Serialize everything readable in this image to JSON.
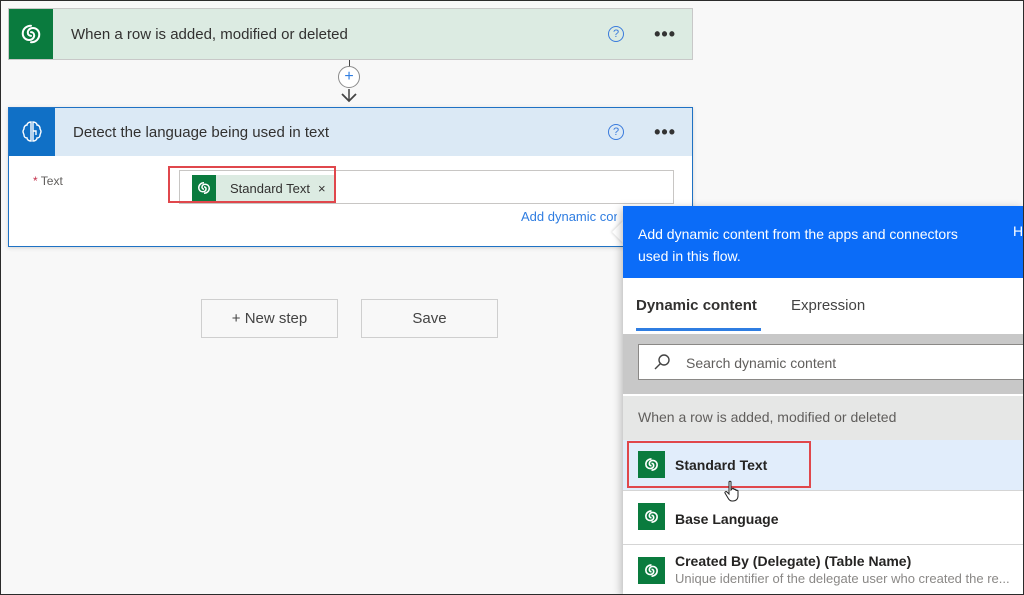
{
  "trigger": {
    "title": "When a row is added, modified or deleted",
    "icon": "dataverse-icon",
    "help_icon": "?",
    "more_icon": "•••",
    "color": "#0a7b3e"
  },
  "connector": {
    "add_icon": "+"
  },
  "action": {
    "title": "Detect the language being used in text",
    "icon": "ai-brain-icon",
    "help_icon": "?",
    "more_icon": "•••",
    "color": "#1070c6",
    "field": {
      "required_mark": "*",
      "label": "Text",
      "token_label": "Standard Text",
      "token_remove": "×"
    },
    "add_dynamic_link": "Add dynamic content"
  },
  "buttons": {
    "new_step": "+ New step",
    "save": "Save"
  },
  "dynamic_panel": {
    "description": "Add dynamic content from the apps and connectors used in this flow.",
    "hide_label": "Hide",
    "tabs": [
      {
        "label": "Dynamic content",
        "active": true
      },
      {
        "label": "Expression",
        "active": false
      }
    ],
    "search_placeholder": "Search dynamic content",
    "section_label": "When a row is added, modified or deleted",
    "items": [
      {
        "label": "Standard Text",
        "description": "",
        "highlighted": true
      },
      {
        "label": "Base Language",
        "description": ""
      },
      {
        "label": "Created By (Delegate) (Table Name)",
        "description": "Unique identifier of the delegate user who created the re..."
      }
    ],
    "accent": "#0b6cf8"
  }
}
